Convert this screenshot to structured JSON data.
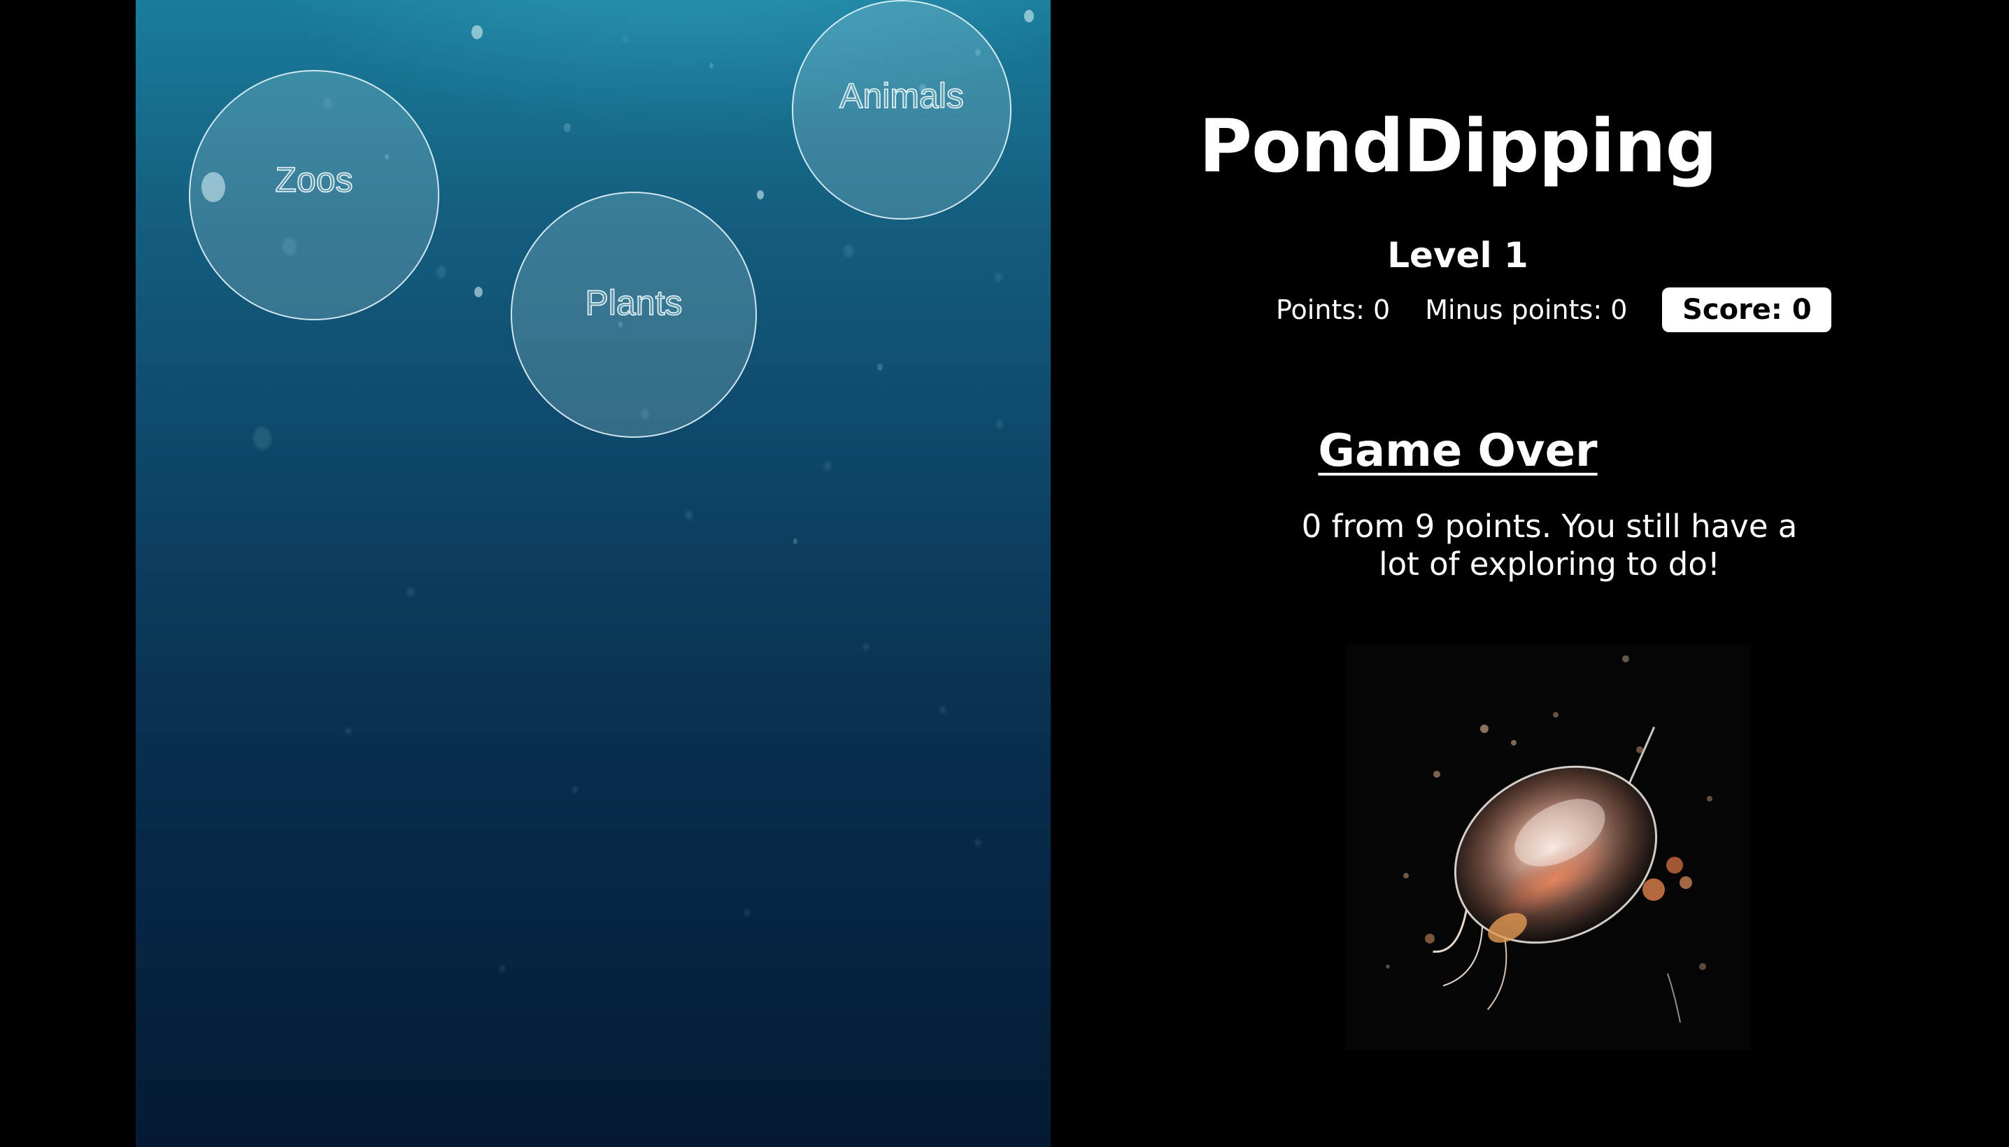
{
  "game": {
    "bubbles": [
      {
        "label": "Zoos"
      },
      {
        "label": "Plants"
      },
      {
        "label": "Animals"
      }
    ]
  },
  "panel": {
    "title": "PondDipping",
    "level": "Level 1",
    "points": "Points: 0",
    "minus_points": "Minus points: 0",
    "score": "Score: 0",
    "game_over": "Game Over",
    "message": "0 from 9 points. You still have a lot of exploring to do!"
  },
  "image": {
    "subject": "water-flea"
  },
  "colors": {
    "background": "#000000",
    "water_top": "#1a7d9b",
    "water_bottom": "#041a33",
    "text": "#ffffff",
    "score_badge": "#ffffff"
  }
}
